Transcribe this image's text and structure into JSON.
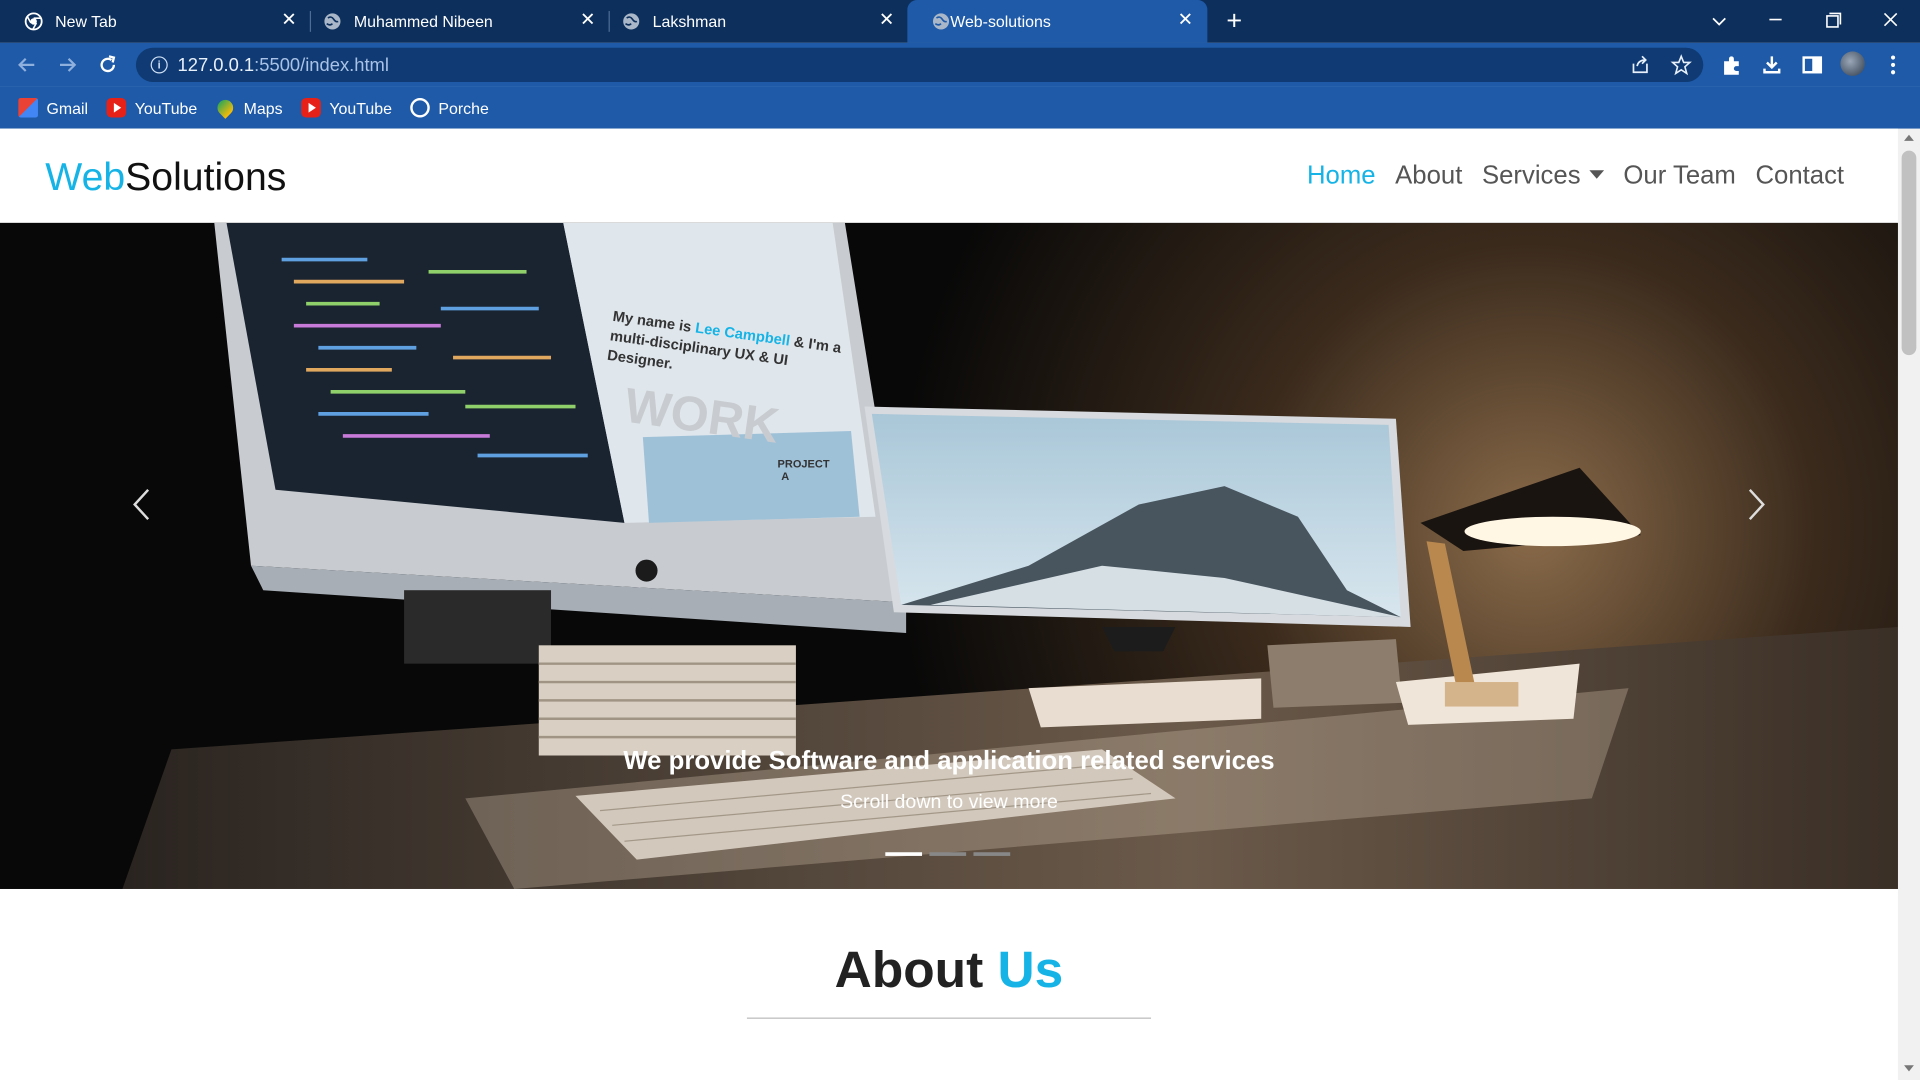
{
  "browser": {
    "tabs": [
      {
        "title": "New Tab",
        "icon": "chrome-icon"
      },
      {
        "title": "Muhammed Nibeen",
        "icon": "globe-icon"
      },
      {
        "title": "Lakshman",
        "icon": "globe-icon"
      },
      {
        "title": "Web-solutions",
        "icon": "globe-icon",
        "active": true
      }
    ],
    "address": {
      "host": "127.0.0.1",
      "rest": ":5500/index.html"
    },
    "bookmarks": [
      {
        "label": "Gmail",
        "icon": "gmail-icon"
      },
      {
        "label": "YouTube",
        "icon": "youtube-icon"
      },
      {
        "label": "Maps",
        "icon": "maps-icon"
      },
      {
        "label": "YouTube",
        "icon": "youtube-icon"
      },
      {
        "label": "Porche",
        "icon": "globe-icon"
      }
    ],
    "colors": {
      "tabstrip": "#0d2f5c",
      "toolbar": "#1e5aa8"
    }
  },
  "site": {
    "brand": {
      "accent": "Web",
      "rest": "Solutions"
    },
    "nav": {
      "home": "Home",
      "about": "About",
      "services": "Services",
      "team": "Our Team",
      "contact": "Contact"
    },
    "hero": {
      "title": "We provide Software and application related services",
      "subtitle": "Scroll down to view more",
      "slide_count": 3,
      "active_slide": 1,
      "image_text": {
        "headline_start": "My name is ",
        "headline_name": "Lee Campbell",
        "headline_end": " & I'm a",
        "line2": "multi-disciplinary UX & UI",
        "line3": "Designer.",
        "watermark": "WORK",
        "project": "PROJECT",
        "project_letter": "A"
      }
    },
    "about": {
      "word1": "About",
      "word2": "Us"
    },
    "colors": {
      "accent": "#16b4e6",
      "text": "#222222"
    }
  }
}
